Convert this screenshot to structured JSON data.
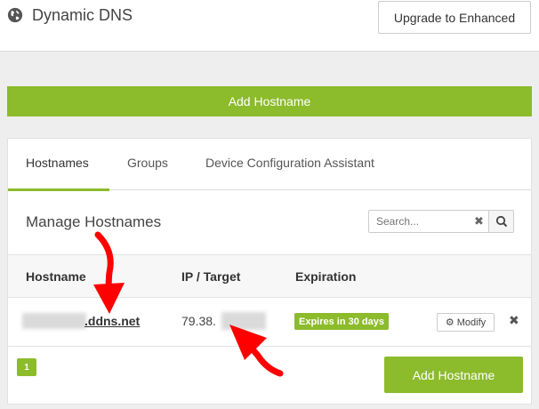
{
  "header": {
    "title": "Dynamic DNS",
    "upgrade_label": "Upgrade to Enhanced",
    "icon": "globe-icon"
  },
  "actions": {
    "add_hostname_top": "Add Hostname",
    "add_hostname_bottom": "Add Hostname"
  },
  "tabs": [
    {
      "label": "Hostnames",
      "active": true
    },
    {
      "label": "Groups",
      "active": false
    },
    {
      "label": "Device Configuration Assistant",
      "active": false
    }
  ],
  "manage": {
    "title": "Manage Hostnames",
    "search_placeholder": "Search...",
    "clear_icon": "close-icon",
    "search_icon": "search-icon"
  },
  "table": {
    "headers": [
      "Hostname",
      "IP / Target",
      "Expiration"
    ],
    "rows": [
      {
        "hostname_suffix": ".ddns.net",
        "ip_prefix": "79.38.",
        "expiration": "Expires in 30 days",
        "modify_label": "Modify"
      }
    ]
  },
  "pagination": {
    "current": "1"
  },
  "colors": {
    "accent": "#8cbb2b",
    "annotation_arrow": "#ff0000"
  }
}
